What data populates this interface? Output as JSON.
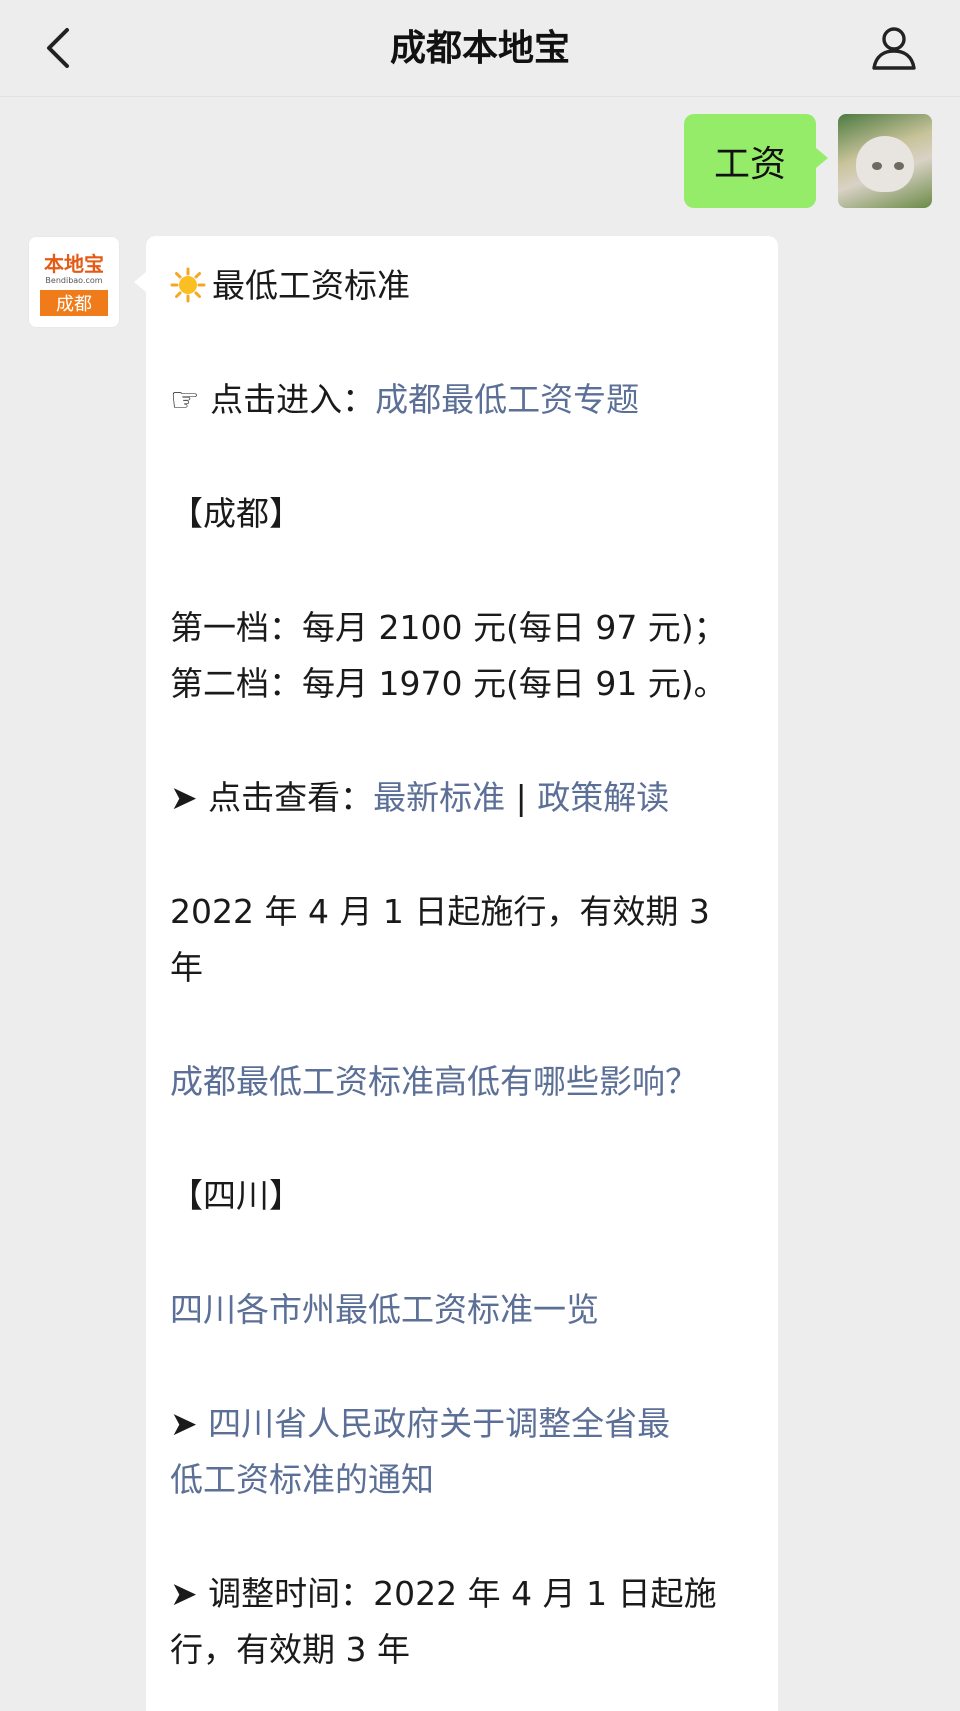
{
  "nav": {
    "title": "成都本地宝",
    "back_icon": "chevron-left-icon",
    "profile_icon": "person-icon"
  },
  "user_message": {
    "text": "工资",
    "bubble_color": "#95ec69"
  },
  "bot": {
    "avatar": {
      "brand": "本地宝",
      "domain": "Bendibao.com",
      "city": "成都"
    },
    "heading": "最低工资标准",
    "entry": {
      "prefix": "☞ 点击进入：",
      "link": "成都最低工资专题"
    },
    "section_chengdu": "【成都】",
    "tier1": "第一档：每月 2100 元(每日 97 元)；",
    "tier2": "第二档：每月 1970 元(每日 91 元)。",
    "view": {
      "prefix": "➤ 点击查看：",
      "link1": "最新标准",
      "separator": " | ",
      "link2": "政策解读"
    },
    "effective": {
      "line1": "2022 年 4 月 1 日起施行，有效期 3",
      "line2": "年"
    },
    "impact_link": "成都最低工资标准高低有哪些影响？",
    "section_sichuan": "【四川】",
    "sichuan_list_link": "四川各市州最低工资标准一览",
    "notice": {
      "arrow": "➤ ",
      "line1": "四川省人民政府关于调整全省最",
      "line2": "低工资标准的通知"
    },
    "adjust": {
      "line1": "➤ 调整时间：2022 年 4 月 1 日起施",
      "line2": "行，有效期 3 年"
    },
    "link_color": "#5b6f97"
  }
}
